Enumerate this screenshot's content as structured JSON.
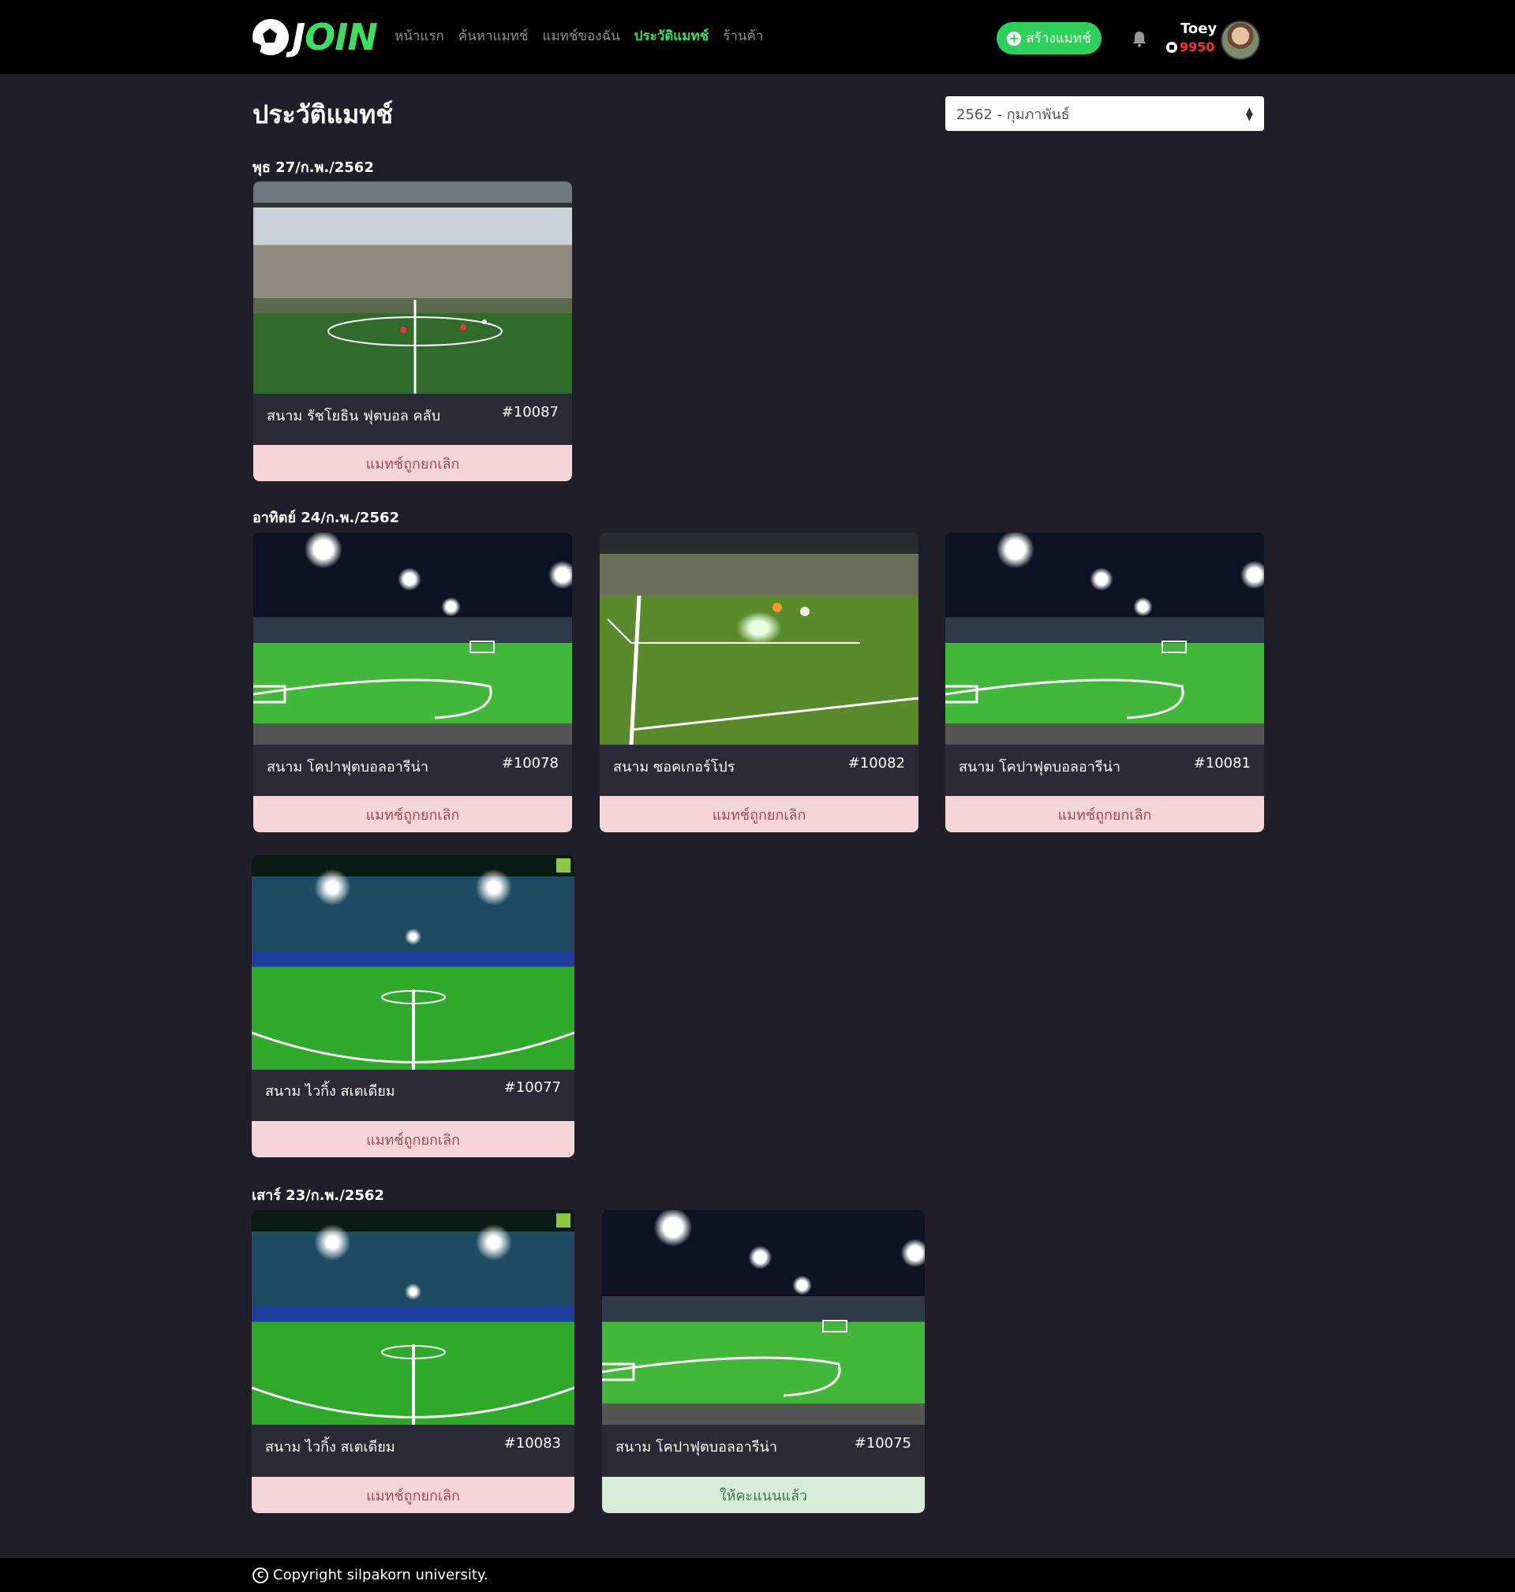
{
  "brand": {
    "logo_text_left": "J",
    "logo_text_right": "OIN"
  },
  "nav": {
    "items": [
      {
        "label": "หน้าแรก",
        "active": false
      },
      {
        "label": "ค้นหาแมทช์",
        "active": false
      },
      {
        "label": "แมทช์ของฉัน",
        "active": false
      },
      {
        "label": "ประวัติแมทช์",
        "active": true
      },
      {
        "label": "ร้านค้า",
        "active": false
      }
    ],
    "create_button": "สร้างแมทช์",
    "user": {
      "name": "Toey",
      "points": "9950"
    }
  },
  "page": {
    "title": "ประวัติแมทช์",
    "month_select": {
      "value": "2562 - กุมภาพันธ์"
    }
  },
  "groups": [
    {
      "date": "พุธ 27/ก.พ./2562",
      "matches": [
        {
          "venue": "สนาม รัชโยธิน ฟุตบอล คลับ",
          "code": "#10087",
          "status": "แมทช์ถูกยกเลิก",
          "status_type": "cancelled",
          "image": "daylight"
        }
      ]
    },
    {
      "date": "อาทิตย์ 24/ก.พ./2562",
      "matches": [
        {
          "venue": "สนาม โคปาฟุตบอลอารีน่า",
          "code": "#10078",
          "status": "แมทช์ถูกยกเลิก",
          "status_type": "cancelled",
          "image": "night"
        },
        {
          "venue": "สนาม ซอคเกอร์โปร",
          "code": "#10082",
          "status": "แมทช์ถูกยกเลิก",
          "status_type": "cancelled",
          "image": "indoor-night"
        },
        {
          "venue": "สนาม โคปาฟุตบอลอารีน่า",
          "code": "#10081",
          "status": "แมทช์ถูกยกเลิก",
          "status_type": "cancelled",
          "image": "night"
        },
        {
          "venue": "สนาม ไวกิ้ง สเตเดียม",
          "code": "#10077",
          "status": "แมทช์ถูกยกเลิก",
          "status_type": "cancelled",
          "image": "arena"
        }
      ]
    },
    {
      "date": "เสาร์ 23/ก.พ./2562",
      "matches": [
        {
          "venue": "สนาม ไวกิ้ง สเตเดียม",
          "code": "#10083",
          "status": "แมทช์ถูกยกเลิก",
          "status_type": "cancelled",
          "image": "arena"
        },
        {
          "venue": "สนาม โคปาฟุตบอลอารีน่า",
          "code": "#10075",
          "status": "ให้คะแนนแล้ว",
          "status_type": "rated",
          "image": "night"
        }
      ]
    }
  ],
  "footer": {
    "text": "Copyright silpakorn university."
  },
  "colors": {
    "background": "#201f29",
    "accent": "#3ddc62",
    "card": "#2b2a36",
    "cancelled_bg": "#f6d5d9",
    "rated_bg": "#d5ecd8",
    "points": "#ff3030"
  },
  "icons": [
    "bell-icon",
    "plus-icon",
    "ball-icon",
    "copyright-icon"
  ]
}
